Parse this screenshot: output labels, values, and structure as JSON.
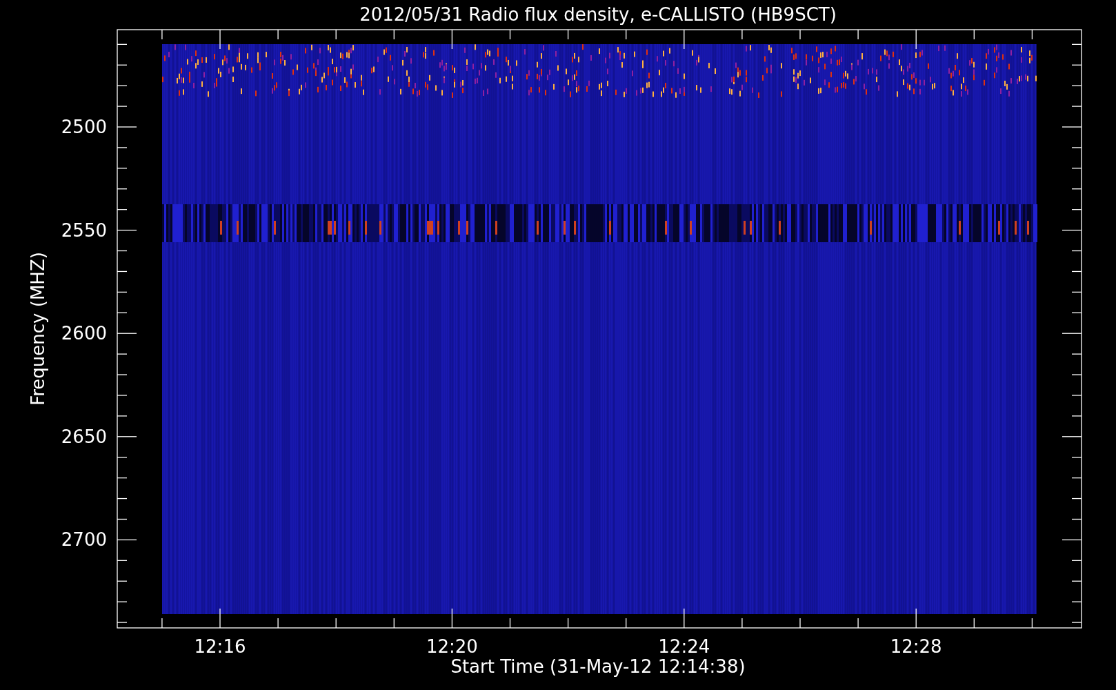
{
  "title": "2012/05/31  Radio flux density, e-CALLISTO (HB9SCT)",
  "y_axis": {
    "label": "Frequency (MHZ)",
    "ticks": [
      "2500",
      "2550",
      "2600",
      "2650",
      "2700"
    ]
  },
  "x_axis": {
    "label": "Start Time (31-May-12 12:14:38)",
    "ticks": [
      "12:16",
      "12:20",
      "12:24",
      "12:28"
    ]
  }
}
